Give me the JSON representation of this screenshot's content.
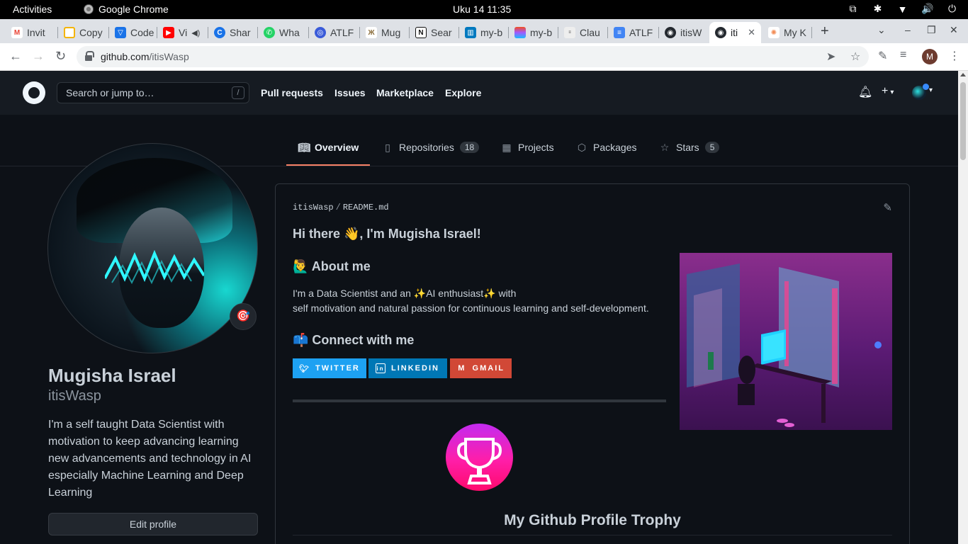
{
  "os_bar": {
    "activities": "Activities",
    "app_name": "Google Chrome",
    "clock": "Uku 14  11:35"
  },
  "tabs": [
    {
      "title": "Invit",
      "icon": "gmail-icon",
      "color": "#ea4335"
    },
    {
      "title": "Copy",
      "icon": "slides-icon",
      "color": "#f4b400"
    },
    {
      "title": "Code",
      "icon": "code-icon",
      "color": "#1a73e8"
    },
    {
      "title": "Vi",
      "icon": "youtube-icon",
      "color": "#ff0000"
    },
    {
      "title": "Shar",
      "icon": "share-icon",
      "color": "#1a73e8"
    },
    {
      "title": "Wha",
      "icon": "whatsapp-icon",
      "color": "#25d366"
    },
    {
      "title": "ATLF",
      "icon": "atlas-icon",
      "color": "#3a5bd9"
    },
    {
      "title": "Mug",
      "icon": "butterfly-icon",
      "color": "#8a6d3b"
    },
    {
      "title": "Sear",
      "icon": "notion-icon",
      "color": "#111111"
    },
    {
      "title": "my-b",
      "icon": "trello-icon",
      "color": "#0079bf"
    },
    {
      "title": "my-b",
      "icon": "figma-icon",
      "color": "#f24e1e"
    },
    {
      "title": "Clau",
      "icon": "claude-icon",
      "color": "#444444"
    },
    {
      "title": "ATLF",
      "icon": "docs-icon",
      "color": "#4285f4"
    },
    {
      "title": "itisW",
      "icon": "github-icon",
      "color": "#24292f"
    },
    {
      "title": "iti",
      "icon": "github-icon",
      "color": "#24292f",
      "active": true
    },
    {
      "title": "My K",
      "icon": "bug-icon",
      "color": "#f28b54"
    }
  ],
  "address_bar": {
    "host": "github.com",
    "path": "/itisWasp"
  },
  "chrome_profile_initial": "M",
  "github_header": {
    "search_placeholder": "Search or jump to…",
    "search_shortcut": "/",
    "nav": [
      "Pull requests",
      "Issues",
      "Marketplace",
      "Explore"
    ]
  },
  "profile_tabs": [
    {
      "label": "Overview",
      "icon": "book-icon",
      "active": true
    },
    {
      "label": "Repositories",
      "icon": "repo-icon",
      "count": "18"
    },
    {
      "label": "Projects",
      "icon": "table-icon"
    },
    {
      "label": "Packages",
      "icon": "package-icon"
    },
    {
      "label": "Stars",
      "icon": "star-icon",
      "count": "5"
    }
  ],
  "profile": {
    "full_name": "Mugisha Israel",
    "username": "itisWasp",
    "status_emoji": "🎯",
    "bio": "I'm a self taught Data Scientist with motivation to keep advancing learning new advancements and technology in AI especially Machine Learning and Deep Learning",
    "edit_label": "Edit profile"
  },
  "readme": {
    "owner": "itisWasp",
    "file": "README.md",
    "heading": "Hi there 👋, I'm Mugisha Israel!",
    "about_heading": "🙋‍♂️ About me",
    "about_line1": "I'm a Data Scientist and an ✨AI enthusiast✨ with",
    "about_line2": "self motivation and natural passion for continuous learning and self-development.",
    "connect_heading": "📫 Connect with me",
    "badges": [
      {
        "label": "TWITTER",
        "color": "#1da1f2",
        "icon": "twitter-icon"
      },
      {
        "label": "LINKEDIN",
        "color": "#0077b5",
        "icon": "linkedin-icon"
      },
      {
        "label": "GMAIL",
        "color": "#d14836",
        "icon": "gmail-icon"
      }
    ],
    "trophy_title": "My Github Profile Trophy"
  },
  "colors": {
    "page_bg": "#0d1117",
    "header_bg": "#161b22",
    "accent_underline": "#f78166",
    "text": "#c9d1d9"
  }
}
